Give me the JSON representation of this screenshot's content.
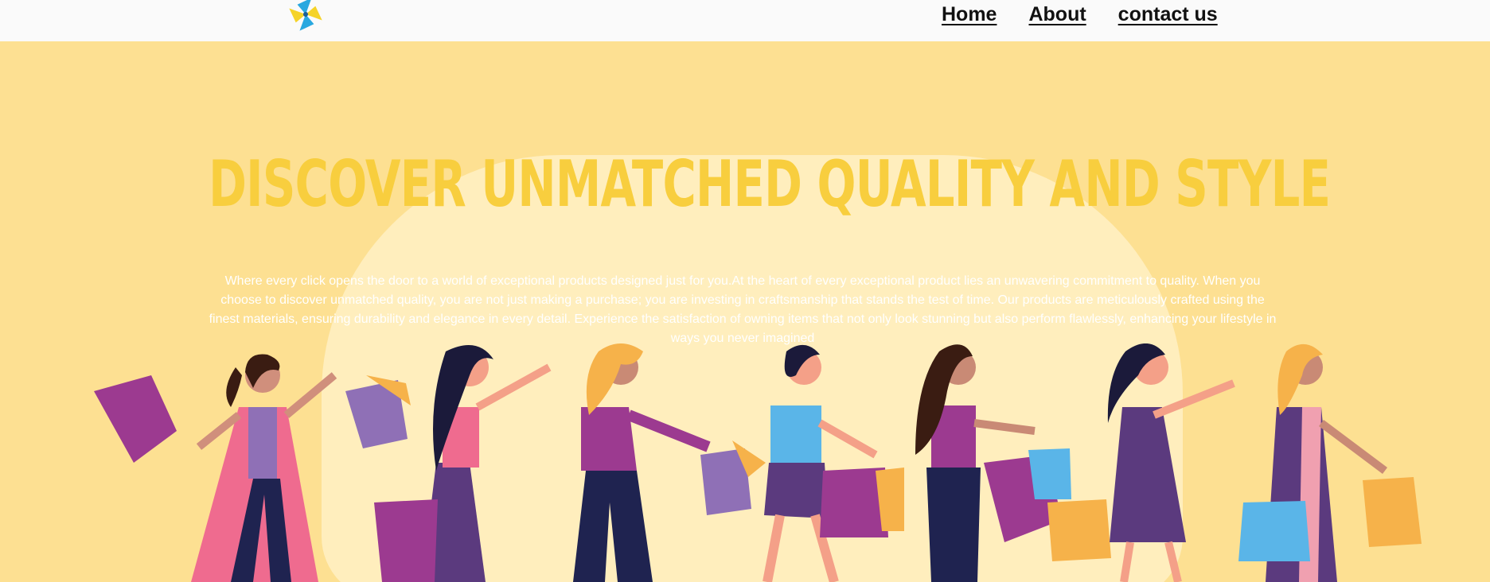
{
  "header": {
    "nav": [
      {
        "label": "Home"
      },
      {
        "label": "About"
      },
      {
        "label": "contact us"
      }
    ]
  },
  "hero": {
    "title": "DISCOVER UNMATCHED QUALITY AND STYLE",
    "description": "Where every click opens the door to a world of exceptional products designed just for you.At the heart of every exceptional product lies an unwavering commitment to quality. When you choose to discover unmatched quality, you are not just making a purchase; you are investing in craftsmanship that stands the test of time. Our products are meticulously crafted using the finest materials, ensuring durability and elegance in every detail. Experience the satisfaction of owning items that not only look stunning but also perform flawlessly, enhancing your lifestyle in ways you never imagined"
  },
  "colors": {
    "background": "#fde092",
    "title": "#f8ce3e",
    "header": "#fafafa",
    "text": "#ffffff"
  },
  "icons": {
    "logo": "pinwheel-logo-icon"
  }
}
